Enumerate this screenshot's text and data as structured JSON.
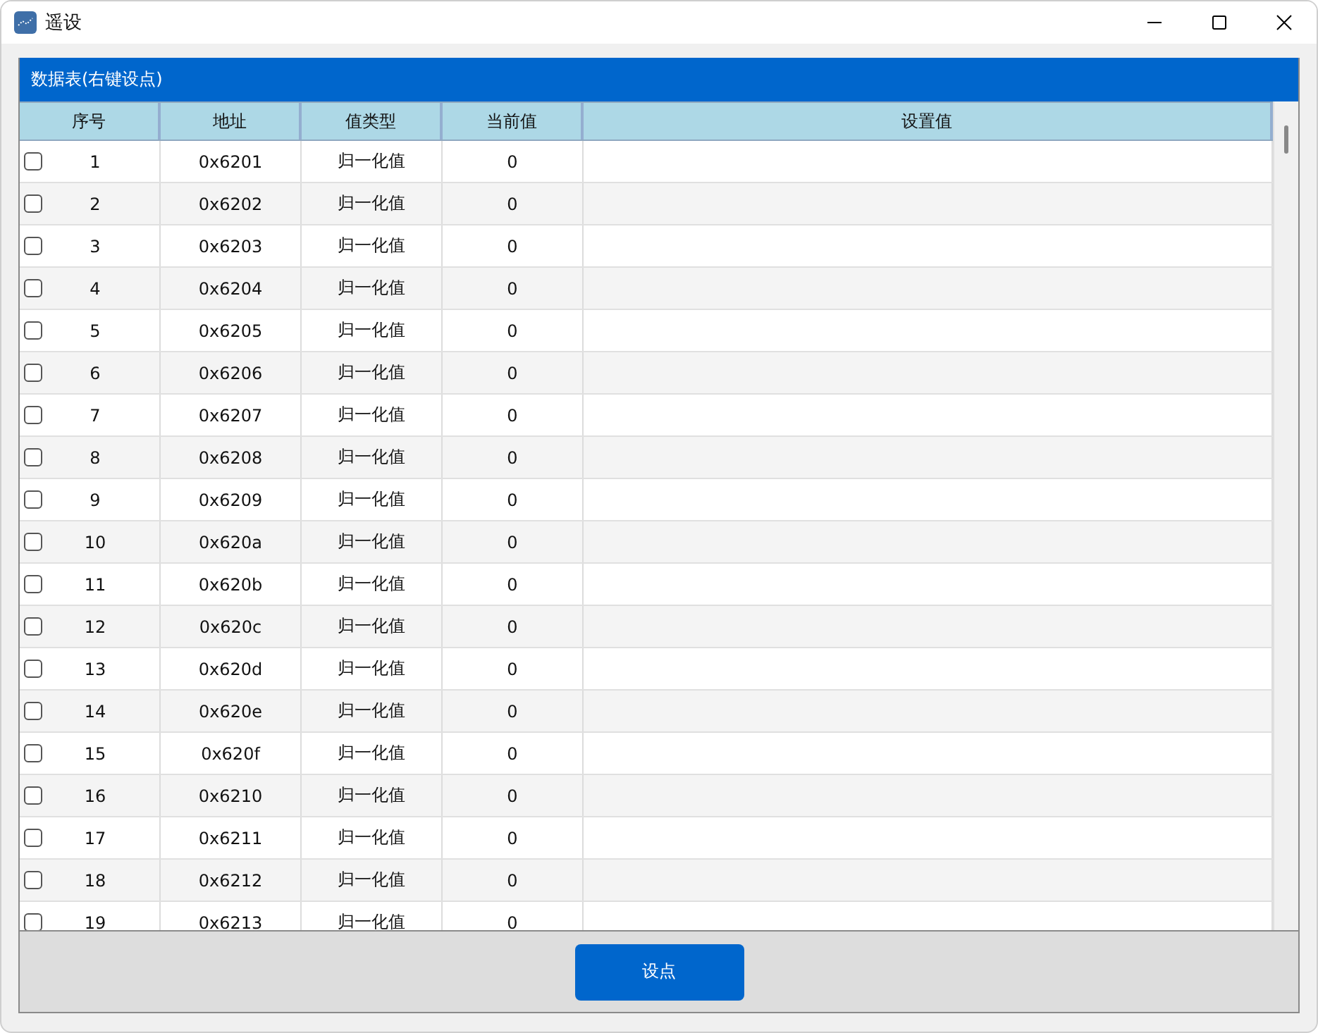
{
  "window": {
    "title": "遥设"
  },
  "panel": {
    "title": "数据表(右键设点)"
  },
  "table": {
    "columns": [
      "序号",
      "地址",
      "值类型",
      "当前值",
      "设置值"
    ],
    "rows": [
      {
        "checked": false,
        "index": "1",
        "address": "0x6201",
        "value_type": "归一化值",
        "current_value": "0"
      },
      {
        "checked": false,
        "index": "2",
        "address": "0x6202",
        "value_type": "归一化值",
        "current_value": "0"
      },
      {
        "checked": false,
        "index": "3",
        "address": "0x6203",
        "value_type": "归一化值",
        "current_value": "0"
      },
      {
        "checked": false,
        "index": "4",
        "address": "0x6204",
        "value_type": "归一化值",
        "current_value": "0"
      },
      {
        "checked": false,
        "index": "5",
        "address": "0x6205",
        "value_type": "归一化值",
        "current_value": "0"
      },
      {
        "checked": false,
        "index": "6",
        "address": "0x6206",
        "value_type": "归一化值",
        "current_value": "0"
      },
      {
        "checked": false,
        "index": "7",
        "address": "0x6207",
        "value_type": "归一化值",
        "current_value": "0"
      },
      {
        "checked": false,
        "index": "8",
        "address": "0x6208",
        "value_type": "归一化值",
        "current_value": "0"
      },
      {
        "checked": false,
        "index": "9",
        "address": "0x6209",
        "value_type": "归一化值",
        "current_value": "0"
      },
      {
        "checked": false,
        "index": "10",
        "address": "0x620a",
        "value_type": "归一化值",
        "current_value": "0"
      },
      {
        "checked": false,
        "index": "11",
        "address": "0x620b",
        "value_type": "归一化值",
        "current_value": "0"
      },
      {
        "checked": false,
        "index": "12",
        "address": "0x620c",
        "value_type": "归一化值",
        "current_value": "0"
      },
      {
        "checked": false,
        "index": "13",
        "address": "0x620d",
        "value_type": "归一化值",
        "current_value": "0"
      },
      {
        "checked": false,
        "index": "14",
        "address": "0x620e",
        "value_type": "归一化值",
        "current_value": "0"
      },
      {
        "checked": false,
        "index": "15",
        "address": "0x620f",
        "value_type": "归一化值",
        "current_value": "0"
      },
      {
        "checked": false,
        "index": "16",
        "address": "0x6210",
        "value_type": "归一化值",
        "current_value": "0"
      },
      {
        "checked": false,
        "index": "17",
        "address": "0x6211",
        "value_type": "归一化值",
        "current_value": "0"
      },
      {
        "checked": false,
        "index": "18",
        "address": "0x6212",
        "value_type": "归一化值",
        "current_value": "0"
      },
      {
        "checked": false,
        "index": "19",
        "address": "0x6213",
        "value_type": "归一化值",
        "current_value": "0"
      }
    ]
  },
  "buttons": [
    "设点"
  ]
}
